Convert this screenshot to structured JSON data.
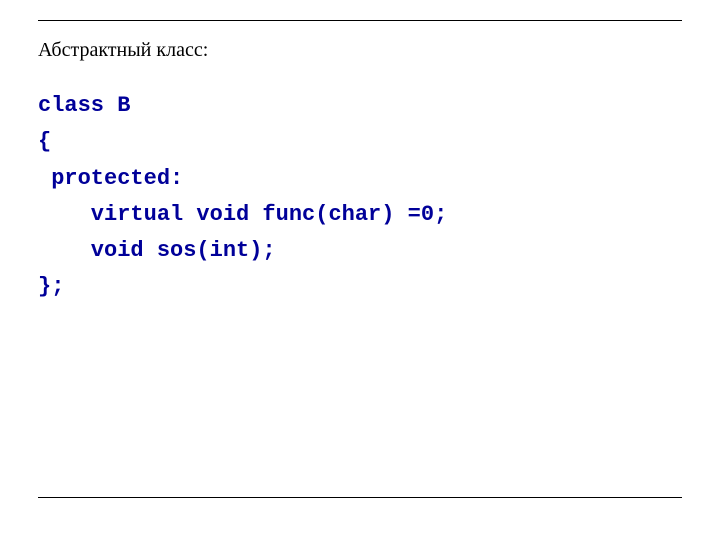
{
  "title": "Абстрактный класс:",
  "code": {
    "l1": "class B",
    "l2": "{",
    "l3": " protected:",
    "l4": "    virtual void func(char) =0;",
    "l5": "    void sos(int);",
    "l6": "};"
  }
}
